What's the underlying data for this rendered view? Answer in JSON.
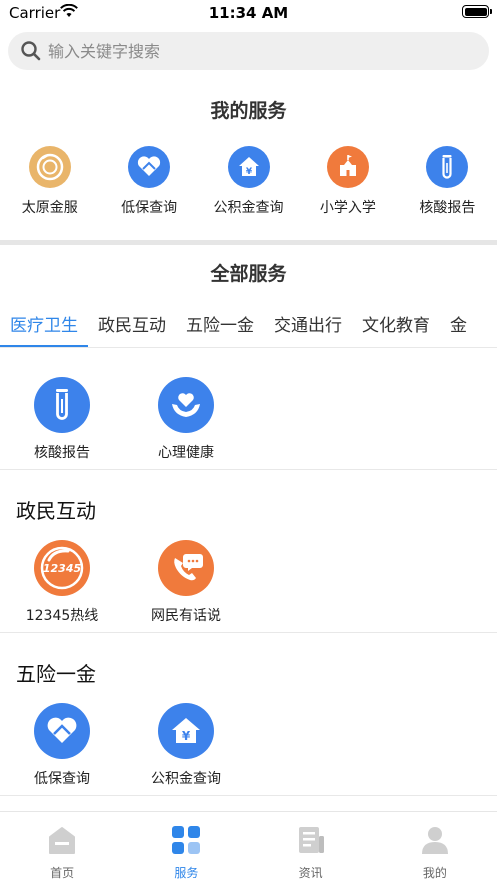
{
  "status": {
    "carrier": "Carrier",
    "time": "11:34 AM"
  },
  "search": {
    "placeholder": "输入关键字搜索"
  },
  "my_services": {
    "title": "我的服务",
    "items": [
      {
        "label": "太原金服",
        "icon": "coin-icon",
        "color": "#e9b56a"
      },
      {
        "label": "低保查询",
        "icon": "heart-icon",
        "color": "#3d82eb"
      },
      {
        "label": "公积金查询",
        "icon": "house-yen-icon",
        "color": "#3d82eb"
      },
      {
        "label": "小学入学",
        "icon": "school-icon",
        "color": "#f07a3c"
      },
      {
        "label": "核酸报告",
        "icon": "test-tube-icon",
        "color": "#3d82eb"
      }
    ]
  },
  "all_services": {
    "title": "全部服务",
    "tabs": [
      "医疗卫生",
      "政民互动",
      "五险一金",
      "交通出行",
      "文化教育",
      "金"
    ],
    "active_tab": 0,
    "groups": [
      {
        "title": "",
        "items": [
          {
            "label": "核酸报告",
            "icon": "test-tube-icon",
            "color": "#3d82eb"
          },
          {
            "label": "心理健康",
            "icon": "heart-hands-icon",
            "color": "#3d82eb"
          }
        ]
      },
      {
        "title": "政民互动",
        "items": [
          {
            "label": "12345热线",
            "icon": "hotline-12345-icon",
            "color": "#f07a3c",
            "badge": "12345"
          },
          {
            "label": "网民有话说",
            "icon": "phone-chat-icon",
            "color": "#f07a3c"
          }
        ]
      },
      {
        "title": "五险一金",
        "items": [
          {
            "label": "低保查询",
            "icon": "heart-icon",
            "color": "#3d82eb"
          },
          {
            "label": "公积金查询",
            "icon": "house-yen-icon",
            "color": "#3d82eb"
          }
        ]
      }
    ]
  },
  "tabbar": {
    "items": [
      {
        "label": "首页",
        "icon": "home-icon"
      },
      {
        "label": "服务",
        "icon": "grid-icon",
        "active": true
      },
      {
        "label": "资讯",
        "icon": "news-icon"
      },
      {
        "label": "我的",
        "icon": "user-icon"
      }
    ]
  },
  "colors": {
    "accent": "#2f86e9",
    "orange": "#f07a3c",
    "gold": "#e9b56a"
  }
}
